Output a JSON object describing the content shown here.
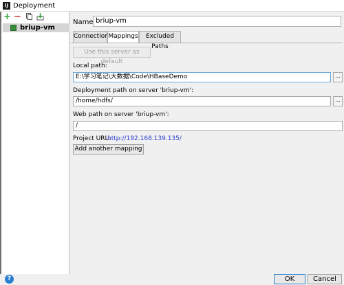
{
  "window": {
    "title": "Deployment",
    "app_icon_label": "IJ"
  },
  "sidebar": {
    "toolbar": {
      "add": "+",
      "remove": "−"
    },
    "servers": [
      {
        "label": "briup-vm"
      }
    ]
  },
  "main": {
    "name_label": "Name:",
    "name_value": "briup-vm",
    "tabs": [
      {
        "label": "Connection",
        "active": false
      },
      {
        "label": "Mappings",
        "active": true
      },
      {
        "label": "Excluded Paths",
        "active": false
      }
    ],
    "default_button": "Use this server as default",
    "local_path_label": "Local path:",
    "local_path_value": "E:\\学习笔记\\大数据\\Code\\HBaseDemo",
    "deployment_path_label": "Deployment path on server 'briup-vm':",
    "deployment_path_value": "/home/hdfs/",
    "web_path_label": "Web path on server 'briup-vm':",
    "web_path_value": "/",
    "project_url_label": "Project URL:",
    "project_url_value": "http://192.168.139.135/",
    "add_mapping_button": "Add another mapping",
    "browse_label": "..."
  },
  "footer": {
    "ok": "OK",
    "cancel": "Cancel",
    "help": "?"
  }
}
